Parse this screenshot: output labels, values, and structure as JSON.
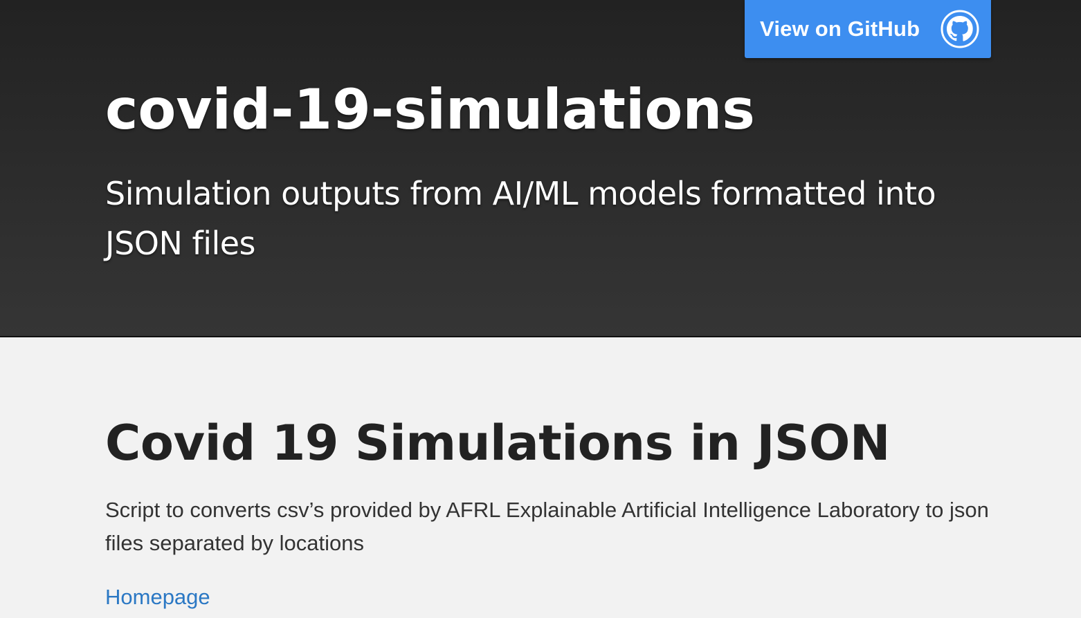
{
  "header": {
    "github_button_label": "View on GitHub",
    "github_icon": "github-octocat-icon",
    "project_title": "covid-19-simulations",
    "project_tagline": "Simulation outputs from AI/ML models formatted into JSON files"
  },
  "main": {
    "heading": "Covid 19 Simulations in JSON",
    "description": "Script to converts csv’s provided by AFRL Explainable Artificial Intelligence Laboratory to json files separated by locations",
    "homepage_link": "Homepage"
  },
  "colors": {
    "header_background": "#2b2b2b",
    "github_button": "#3d8ef0",
    "page_background": "#f2f2f2",
    "link": "#2b78c4"
  }
}
